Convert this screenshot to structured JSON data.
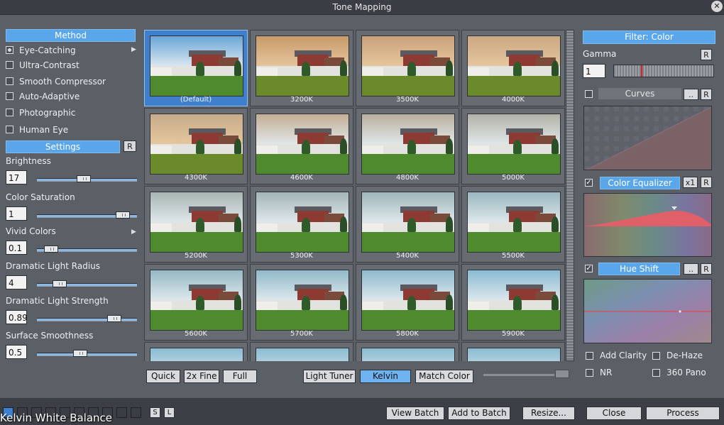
{
  "window": {
    "title": "Tone Mapping"
  },
  "left": {
    "method_header": "Method",
    "methods": [
      {
        "label": "Eye-Catching",
        "selected": true,
        "has_arrow": true
      },
      {
        "label": "Ultra-Contrast",
        "selected": false
      },
      {
        "label": "Smooth Compressor",
        "selected": false
      },
      {
        "label": "Auto-Adaptive",
        "selected": false
      },
      {
        "label": "Photographic",
        "selected": false
      },
      {
        "label": "Human Eye",
        "selected": false
      }
    ],
    "settings_header": "Settings",
    "reset_label": "R",
    "params": [
      {
        "label": "Brightness",
        "value": "17",
        "level": 0.46
      },
      {
        "label": "Color Saturation",
        "value": "1",
        "level": 0.92
      },
      {
        "label": "Vivid Colors",
        "value": "0.1",
        "level": 0.08
      },
      {
        "label": "Dramatic Light Radius",
        "value": "4",
        "level": 0.18
      },
      {
        "label": "Dramatic Light Strength",
        "value": "0.89",
        "level": 0.82
      },
      {
        "label": "Surface Smoothness",
        "value": "0.5",
        "level": 0.42
      }
    ]
  },
  "grid": {
    "cells": [
      "(Default)",
      "3200K",
      "3500K",
      "4000K",
      "4300K",
      "4600K",
      "4800K",
      "5000K",
      "5200K",
      "5300K",
      "5400K",
      "5500K",
      "5600K",
      "5700K",
      "5800K",
      "5900K",
      "",
      "",
      "",
      ""
    ],
    "selected_index": 0
  },
  "toolbar": {
    "quality": [
      "Quick",
      "2x Fine",
      "Full"
    ],
    "modes": [
      "Light Tuner",
      "Kelvin",
      "Match Color"
    ],
    "active_mode": "Kelvin"
  },
  "right": {
    "filter_header": "Filter: Color",
    "gamma_label": "Gamma",
    "gamma_value": "1",
    "reset_label": "R",
    "curves_label": "Curves",
    "dots_label": "..",
    "color_eq_label": "Color Equalizer",
    "x1_label": "x1",
    "hue_shift_label": "Hue Shift",
    "options": [
      {
        "label": "Add Clarity",
        "checked": false
      },
      {
        "label": "De-Haze",
        "checked": false
      },
      {
        "label": "NR",
        "checked": false
      },
      {
        "label": "360 Pano",
        "checked": false
      }
    ]
  },
  "bottom": {
    "s_label": "S",
    "l_label": "L",
    "buttons": [
      "View Batch",
      "Add to Batch",
      "Resize...",
      "Close",
      "Process"
    ],
    "caption": "Kelvin White Balance"
  }
}
